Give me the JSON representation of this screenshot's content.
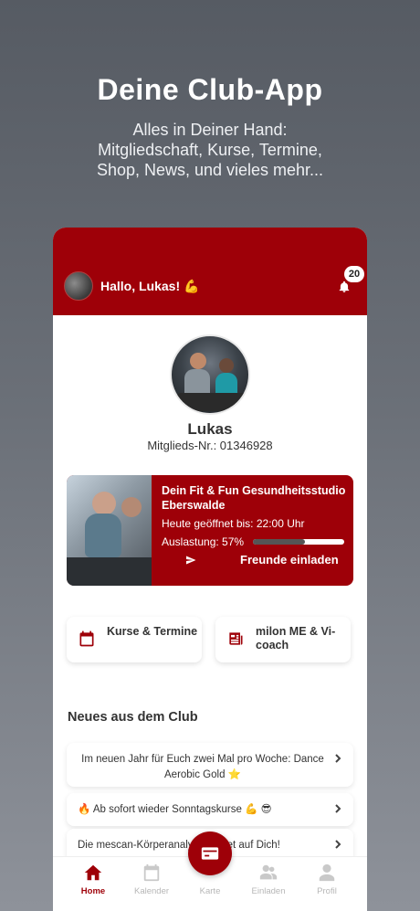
{
  "promo": {
    "title": "Deine Club-App",
    "subtitle_line1": "Alles in Deiner Hand:",
    "subtitle_line2": "Mitgliedschaft, Kurse, Termine,",
    "subtitle_line3": "Shop, News, und vieles mehr..."
  },
  "header": {
    "greeting": "Hallo, Lukas! 💪",
    "notification_count": "20"
  },
  "profile": {
    "name": "Lukas",
    "member_number": "Mitglieds-Nr.: 01346928"
  },
  "studio": {
    "title": "Dein Fit & Fun Gesundheitsstudio Eberswalde",
    "open_until": "Heute geöffnet bis: 22:00 Uhr",
    "load_label": "Auslastung: 57%",
    "load_fraction": 0.57,
    "invite_label": "Freunde einladen"
  },
  "tiles": [
    {
      "label": "Kurse & Termine",
      "icon": "calendar-icon"
    },
    {
      "label": "milon ME & Vi-coach",
      "icon": "news-icon"
    }
  ],
  "news_section": {
    "title": "Neues aus dem Club",
    "items": [
      {
        "text": "Im neuen Jahr für Euch zwei Mal pro Woche: Dance Aerobic Gold ⭐"
      },
      {
        "text": "🔥 Ab sofort wieder Sonntagskurse 💪 😎"
      },
      {
        "text": "Die mescan-Körperanalyse wartet auf Dich!"
      }
    ]
  },
  "tabbar": {
    "tabs": [
      {
        "label": "Home",
        "icon": "home-icon"
      },
      {
        "label": "Kalender",
        "icon": "calendar-icon"
      },
      {
        "label": "Karte",
        "icon": "card-icon"
      },
      {
        "label": "Einladen",
        "icon": "people-icon"
      },
      {
        "label": "Profil",
        "icon": "person-icon"
      }
    ]
  },
  "colors": {
    "brand_red": "#9e0008",
    "background_gradient_top": "#565b63",
    "background_gradient_bottom": "#8e929a"
  }
}
